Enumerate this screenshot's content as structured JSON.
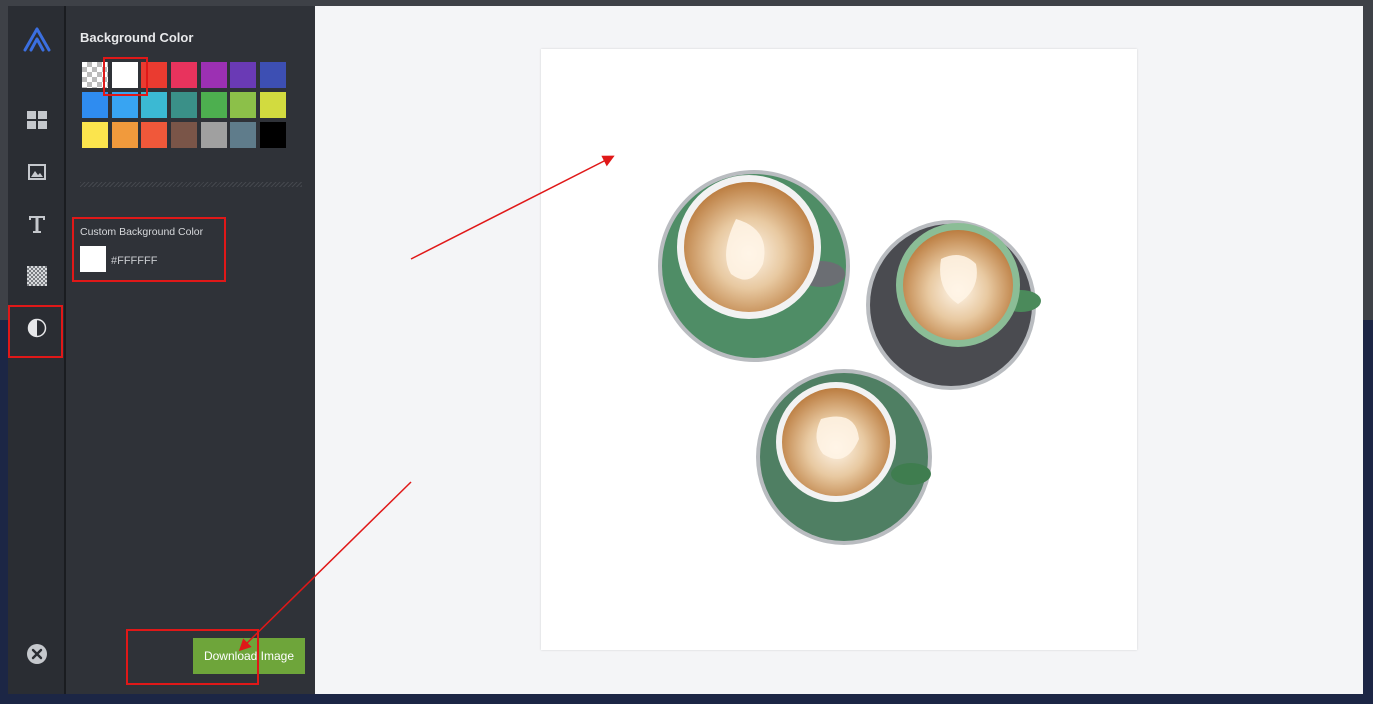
{
  "panel": {
    "title": "Background Color",
    "swatches": [
      {
        "name": "transparent",
        "color": "transparent"
      },
      {
        "name": "white",
        "color": "#ffffff"
      },
      {
        "name": "red",
        "color": "#ea3b30"
      },
      {
        "name": "pink",
        "color": "#e8335d"
      },
      {
        "name": "purple",
        "color": "#9c30b3"
      },
      {
        "name": "deep-purple",
        "color": "#6a3ab5"
      },
      {
        "name": "indigo",
        "color": "#3d4fb3"
      },
      {
        "name": "blue",
        "color": "#2f8cf0"
      },
      {
        "name": "light-blue",
        "color": "#38a4f2"
      },
      {
        "name": "cyan",
        "color": "#3bb9d3"
      },
      {
        "name": "teal",
        "color": "#3a9088"
      },
      {
        "name": "green",
        "color": "#4daf4f"
      },
      {
        "name": "light-green",
        "color": "#8cc049"
      },
      {
        "name": "lime",
        "color": "#d2db3f"
      },
      {
        "name": "yellow",
        "color": "#fbe44d"
      },
      {
        "name": "orange",
        "color": "#f19a3c"
      },
      {
        "name": "deep-orange",
        "color": "#f0583a"
      },
      {
        "name": "brown",
        "color": "#7a5548"
      },
      {
        "name": "grey",
        "color": "#a0a0a0"
      },
      {
        "name": "blue-grey",
        "color": "#5f7c8b"
      },
      {
        "name": "black",
        "color": "#000000"
      }
    ],
    "selected_swatch": "white",
    "custom": {
      "label": "Custom Background Color",
      "value": "#FFFFFF",
      "swatch_color": "#ffffff"
    },
    "download_label": "Download Image"
  },
  "rail": {
    "items": [
      {
        "icon": "logo-icon"
      },
      {
        "icon": "layout-icon"
      },
      {
        "icon": "image-icon"
      },
      {
        "icon": "text-icon"
      },
      {
        "icon": "transparency-icon"
      },
      {
        "icon": "contrast-icon",
        "active": true
      },
      {
        "icon": "close-icon"
      }
    ]
  },
  "canvas": {
    "background": "#FFFFFF",
    "image": "three-latte-cups"
  },
  "colors": {
    "accent": "#6ea53a",
    "highlight": "#e01818",
    "rail_bg": "#2a2d33",
    "panel_bg": "#2f3238",
    "brand": "#3b6fe0"
  }
}
